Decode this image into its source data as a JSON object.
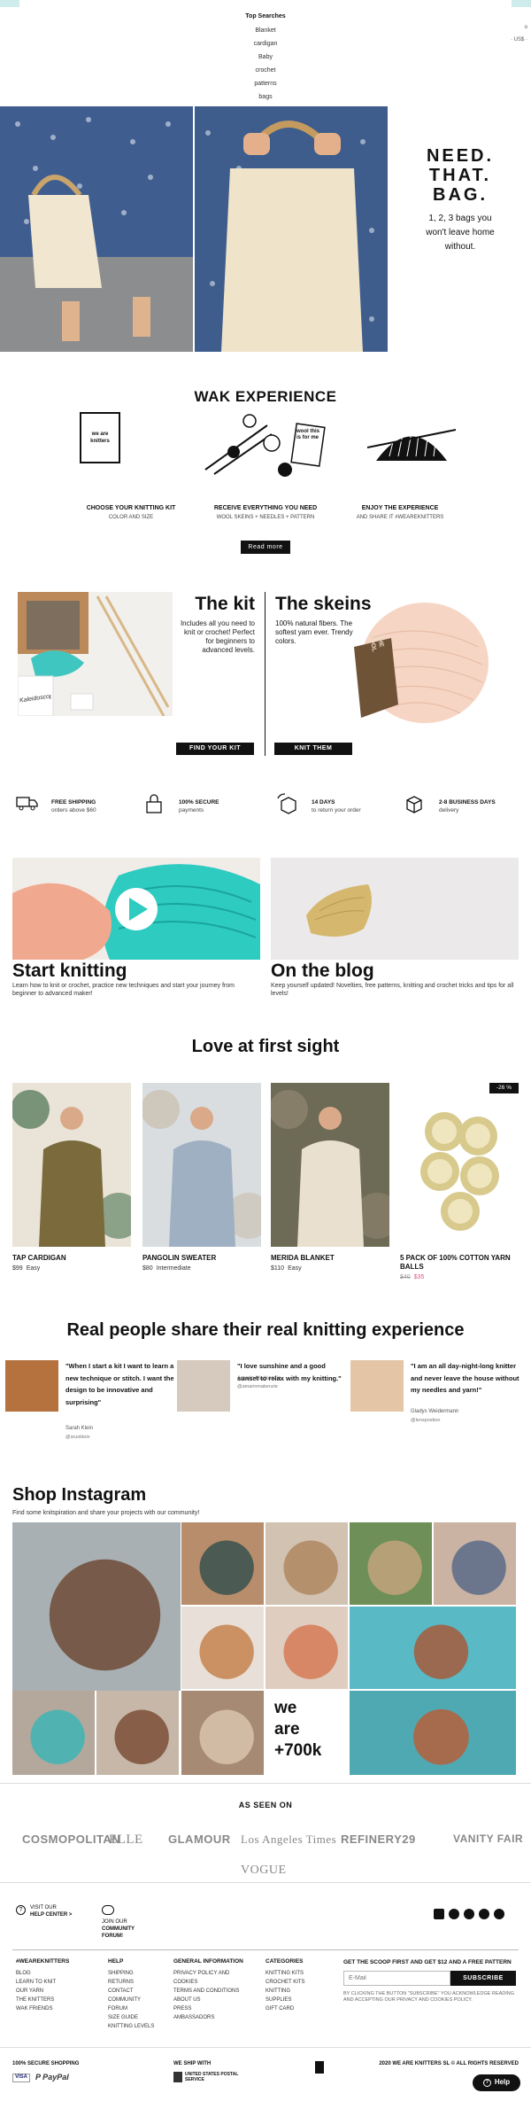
{
  "search_dropdown": {
    "title": "Top Searches",
    "items": [
      "Blanket",
      "cardigan",
      "Baby",
      "crochet",
      "patterns",
      "bags"
    ]
  },
  "header_right": {
    "top": "o",
    "currency": "· US$ ·"
  },
  "hero": {
    "headline_1": "NEED.",
    "headline_2": "THAT.",
    "headline_3": "BAG.",
    "subtitle": "1, 2, 3 bags you won't leave home without."
  },
  "wak_experience": {
    "title": "WAK EXPERIENCE",
    "kit_box_text": "we are knitters",
    "card_text": "wool this is for me",
    "steps": [
      {
        "title": "CHOOSE YOUR KNITTING KIT",
        "subtitle": "COLOR AND SIZE"
      },
      {
        "title": "RECEIVE EVERYTHING YOU NEED",
        "subtitle": "WOOL SKEINS + NEEDLES + PATTERN"
      },
      {
        "title": "ENJOY THE EXPERIENCE",
        "subtitle": "AND SHARE IT #WEAREKNITTERS"
      }
    ],
    "button": "Read more"
  },
  "kit_skeins": {
    "kit_title": "The kit",
    "kit_text": "Includes all you need to knit or crochet! Perfect for beginners to advanced levels.",
    "kit_button": "FIND YOUR KIT",
    "kit_photo_text": "Kaleidoscope",
    "skeins_title": "The skeins",
    "skeins_text": "100% natural fibers. The softest yarn ever. Trendy colors.",
    "skeins_button": "KNIT THEM",
    "skein_label": "THE WOOL"
  },
  "benefits": [
    {
      "title": "FREE SHIPPING",
      "sub": "orders above $60",
      "icon": "truck-icon"
    },
    {
      "title": "100% SECURE",
      "sub": "payments",
      "icon": "lock-icon"
    },
    {
      "title": "14 DAYS",
      "sub": "to return your order",
      "icon": "return-box-icon"
    },
    {
      "title": "2-8 BUSINESS DAYS",
      "sub": "delivery",
      "icon": "package-icon"
    }
  ],
  "start_knitting": {
    "title": "Start knitting",
    "text": "Learn how to knit or crochet, practice new techniques and start your journey from beginner to advanced maker!"
  },
  "blog": {
    "title": "On the blog",
    "text": "Keep yourself updated! Novelties, free patterns, knitting and crochet tricks and tips for all levels!"
  },
  "love": {
    "title": "Love at first sight",
    "products": [
      {
        "name": "TAP CARDIGAN",
        "price": "$99",
        "level": "Easy",
        "badge": ""
      },
      {
        "name": "PANGOLIN SWEATER",
        "price": "$80",
        "level": "Intermediate",
        "badge": ""
      },
      {
        "name": "MERIDA BLANKET",
        "price": "$110",
        "level": "Easy",
        "badge": ""
      },
      {
        "name": "5 PACK OF 100% COTTON YARN BALLS",
        "price": "$40",
        "sale_price": "$35",
        "level": "",
        "badge": "-26 %"
      }
    ]
  },
  "testimonials": {
    "title": "Real people share their real knitting experience",
    "items": [
      {
        "quote": "\"When I start a kit I want to learn a new technique or stitch. I want the design to be innovative and surprising\"",
        "name": "Sarah Klein",
        "handle": "@sruoklein"
      },
      {
        "quote": "\"I love sunshine and a good sunset to relax with my knitting.\"",
        "name": "Amarin Mackenzie",
        "handle": "@amarinmakenzie"
      },
      {
        "quote": "\"I am an all day-night-long knitter and never leave the house without my needles and yarn!\"",
        "name": "Gladys Weidermann",
        "handle": "@lenspostion"
      }
    ]
  },
  "instagram": {
    "title": "Shop Instagram",
    "subtitle": "Find some knitspiration and share your projects with our community!",
    "promo_1": "we",
    "promo_2": "are",
    "promo_3": "+700k"
  },
  "as_seen_on": {
    "title": "AS SEEN ON",
    "logos": [
      "COSMOPOLITAN",
      "ELLE",
      "GLAMOUR",
      "Los Angeles Times",
      "REFINERY29",
      "VANITY FAIR",
      "VOGUE"
    ]
  },
  "footer_top": {
    "visit_label": "VISIT OUR",
    "visit_link": "HELP CENTER >",
    "join_label": "JOIN OUR",
    "join_link_1": "COMMUNITY",
    "join_link_2": "FORUM!",
    "social": [
      "facebook-icon",
      "instagram-icon",
      "pinterest-icon",
      "spotify-icon",
      "youtube-icon"
    ]
  },
  "footer_columns": [
    {
      "title": "#WEAREKNITTERS",
      "links": [
        "BLOG",
        "LEARN TO KNIT",
        "OUR YARN",
        "THE KNITTERS",
        "WAK FRIENDS"
      ]
    },
    {
      "title": "HELP",
      "links": [
        "SHIPPING",
        "RETURNS",
        "CONTACT",
        "COMMUNITY",
        "FORUM",
        "SIZE GUIDE",
        "KNITTING LEVELS"
      ]
    },
    {
      "title": "GENERAL INFORMATION",
      "links": [
        "PRIVACY POLICY AND COOKIES",
        "TERMS AND CONDITIONS",
        "ABOUT US",
        "PRESS",
        "AMBASSADORS"
      ]
    },
    {
      "title": "CATEGORIES",
      "links": [
        "KNITTING KITS",
        "CROCHET KITS",
        "KNITTING",
        "SUPPLIES",
        "GIFT CARD"
      ]
    }
  ],
  "newsletter": {
    "title": "GET THE SCOOP FIRST AND GET $12 AND A FREE PATTERN",
    "placeholder": "E-Mail",
    "button": "SUBSCRIBE",
    "note": "BY CLICKING THE BUTTON \"SUBSCRIBE\" YOU ACKNOWLEDGE READING AND ACCEPTING OUR PRIVACY AND COOKIES POLICY."
  },
  "bottom_bar": {
    "secure": "100% SECURE SHOPPING",
    "payment_1": "VISA",
    "payment_2": "P PayPal",
    "ship_with": "WE SHIP WITH",
    "carrier": "UNITED STATES POSTAL SERVICE",
    "copyright": "2020 WE ARE KNITTERS SL © ALL RIGHTS RESERVED",
    "help_button": "Help"
  },
  "colors": {
    "accent": "#2ecbc1",
    "black": "#111111",
    "sale": "#e0547a",
    "teal_tab": "#cdeceb"
  }
}
